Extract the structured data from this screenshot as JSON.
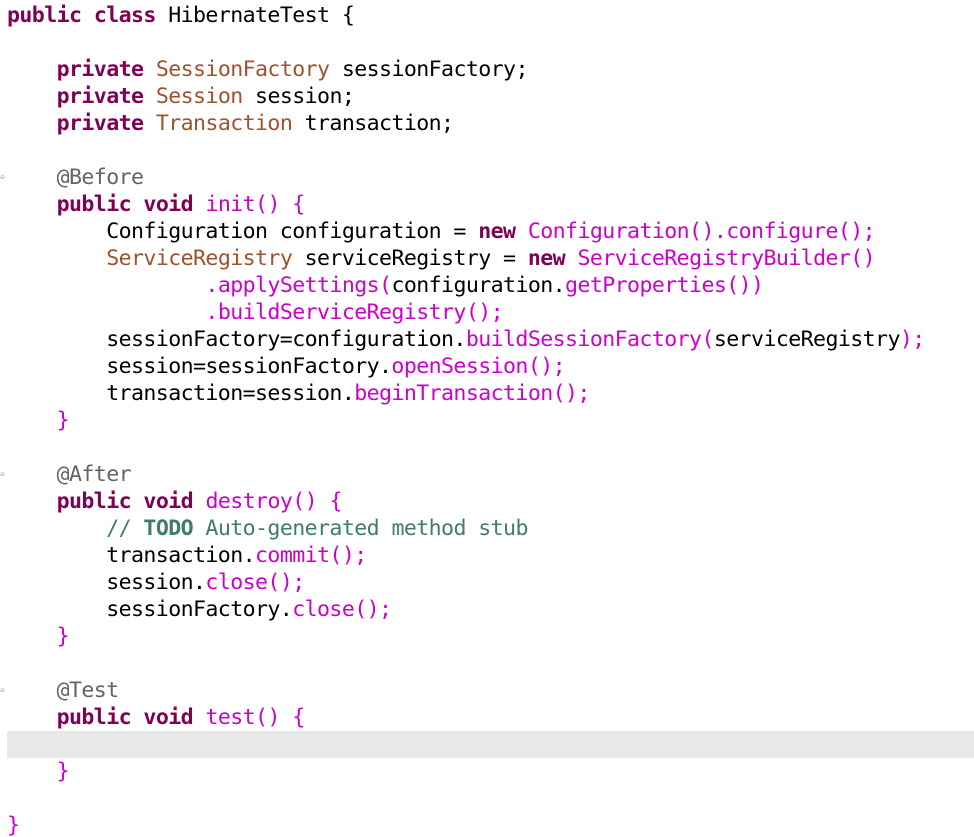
{
  "editor": {
    "lines": [
      {
        "tokens": [
          [
            "kw",
            "public"
          ],
          [
            "plain",
            " "
          ],
          [
            "kw",
            "class"
          ],
          [
            "plain",
            " HibernateTest "
          ],
          [
            "pun",
            "{"
          ]
        ]
      },
      {
        "tokens": []
      },
      {
        "tokens": [
          [
            "plain",
            "    "
          ],
          [
            "kw",
            "private"
          ],
          [
            "plain",
            " "
          ],
          [
            "type",
            "SessionFactory"
          ],
          [
            "plain",
            " sessionFactory;"
          ]
        ]
      },
      {
        "tokens": [
          [
            "plain",
            "    "
          ],
          [
            "kw",
            "private"
          ],
          [
            "plain",
            " "
          ],
          [
            "type",
            "Session"
          ],
          [
            "plain",
            " session;"
          ]
        ]
      },
      {
        "tokens": [
          [
            "plain",
            "    "
          ],
          [
            "kw",
            "private"
          ],
          [
            "plain",
            " "
          ],
          [
            "type",
            "Transaction"
          ],
          [
            "plain",
            " transaction;"
          ]
        ]
      },
      {
        "tokens": []
      },
      {
        "fold": true,
        "tokens": [
          [
            "plain",
            "    "
          ],
          [
            "ann",
            "@Before"
          ]
        ]
      },
      {
        "tokens": [
          [
            "plain",
            "    "
          ],
          [
            "kw",
            "public"
          ],
          [
            "plain",
            " "
          ],
          [
            "kw",
            "void"
          ],
          [
            "plain",
            " "
          ],
          [
            "mth",
            "init"
          ],
          [
            "mth",
            "()"
          ],
          [
            "plain",
            " "
          ],
          [
            "mth",
            "{"
          ]
        ]
      },
      {
        "tokens": [
          [
            "plain",
            "        Configuration configuration = "
          ],
          [
            "kw",
            "new"
          ],
          [
            "plain",
            " "
          ],
          [
            "mth",
            "Configuration().configure();"
          ]
        ]
      },
      {
        "tokens": [
          [
            "plain",
            "        "
          ],
          [
            "type",
            "ServiceRegistry"
          ],
          [
            "plain",
            " serviceRegistry = "
          ],
          [
            "kw",
            "new"
          ],
          [
            "plain",
            " "
          ],
          [
            "mth",
            "ServiceRegistryBuilder()"
          ]
        ]
      },
      {
        "tokens": [
          [
            "plain",
            "                "
          ],
          [
            "mth",
            ".applySettings("
          ],
          [
            "plain",
            "configuration."
          ],
          [
            "mth",
            "getProperties())"
          ]
        ]
      },
      {
        "tokens": [
          [
            "plain",
            "                "
          ],
          [
            "mth",
            ".buildServiceRegistry();"
          ]
        ]
      },
      {
        "tokens": [
          [
            "plain",
            "        sessionFactory=configuration."
          ],
          [
            "mth",
            "buildSessionFactory("
          ],
          [
            "plain",
            "serviceRegistry"
          ],
          [
            "mth",
            ");"
          ]
        ]
      },
      {
        "tokens": [
          [
            "plain",
            "        session=sessionFactory."
          ],
          [
            "mth",
            "openSession();"
          ]
        ]
      },
      {
        "tokens": [
          [
            "plain",
            "        transaction=session."
          ],
          [
            "mth",
            "beginTransaction();"
          ]
        ]
      },
      {
        "tokens": [
          [
            "plain",
            "    "
          ],
          [
            "mth",
            "}"
          ]
        ]
      },
      {
        "tokens": []
      },
      {
        "fold": true,
        "tokens": [
          [
            "plain",
            "    "
          ],
          [
            "ann",
            "@After"
          ]
        ]
      },
      {
        "tokens": [
          [
            "plain",
            "    "
          ],
          [
            "kw",
            "public"
          ],
          [
            "plain",
            " "
          ],
          [
            "kw",
            "void"
          ],
          [
            "plain",
            " "
          ],
          [
            "mth",
            "destroy"
          ],
          [
            "mth",
            "()"
          ],
          [
            "plain",
            " "
          ],
          [
            "mth",
            "{"
          ]
        ]
      },
      {
        "tokens": [
          [
            "plain",
            "        "
          ],
          [
            "cmt",
            "// "
          ],
          [
            "todo",
            "TODO"
          ],
          [
            "cmt",
            " Auto-generated method stub"
          ]
        ]
      },
      {
        "tokens": [
          [
            "plain",
            "        transaction."
          ],
          [
            "mth",
            "commit();"
          ]
        ]
      },
      {
        "tokens": [
          [
            "plain",
            "        session."
          ],
          [
            "mth",
            "close();"
          ]
        ]
      },
      {
        "tokens": [
          [
            "plain",
            "        sessionFactory."
          ],
          [
            "mth",
            "close();"
          ]
        ]
      },
      {
        "tokens": [
          [
            "plain",
            "    "
          ],
          [
            "mth",
            "}"
          ]
        ]
      },
      {
        "tokens": []
      },
      {
        "fold": true,
        "tokens": [
          [
            "plain",
            "    "
          ],
          [
            "ann",
            "@Test"
          ]
        ]
      },
      {
        "tokens": [
          [
            "plain",
            "    "
          ],
          [
            "kw",
            "public"
          ],
          [
            "plain",
            " "
          ],
          [
            "kw",
            "void"
          ],
          [
            "plain",
            " "
          ],
          [
            "mth",
            "test"
          ],
          [
            "mth",
            "()"
          ],
          [
            "plain",
            " "
          ],
          [
            "mth",
            "{"
          ]
        ]
      },
      {
        "current": true,
        "tokens": []
      },
      {
        "tokens": [
          [
            "plain",
            "    "
          ],
          [
            "mth",
            "}"
          ]
        ]
      },
      {
        "tokens": []
      },
      {
        "tokens": [
          [
            "mth",
            "}"
          ]
        ]
      }
    ]
  },
  "colors": {
    "keyword": "#7f0055",
    "type": "#a0522d",
    "annotation": "#646464",
    "method": "#cc00cc",
    "comment": "#3f7f5f",
    "current_line": "#e8e8e8"
  }
}
